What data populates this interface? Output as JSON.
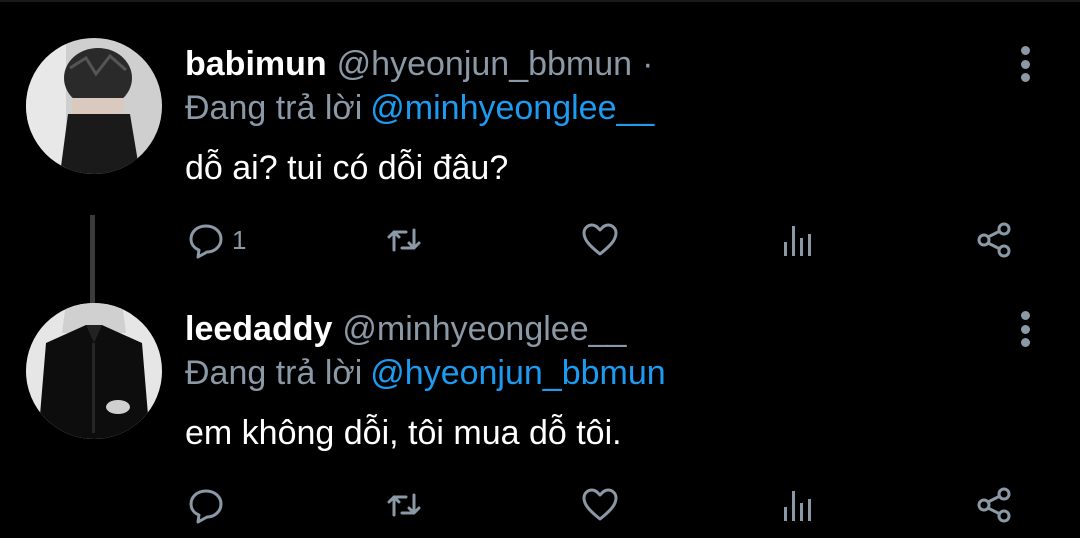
{
  "tweets": [
    {
      "display_name": "babimun",
      "handle": "@hyeonjun_bbmun",
      "separator": "·",
      "reply_prefix": "Đang trả lời",
      "reply_to": "@minhyeonglee__",
      "text": "dỗ ai? tui có dỗi đâu?",
      "reply_count": "1"
    },
    {
      "display_name": "leedaddy",
      "handle": "@minhyeonglee__",
      "reply_prefix": "Đang trả lời",
      "reply_to": "@hyeonjun_bbmun",
      "text": "em không dỗi, tôi mua dỗ tôi.",
      "reply_count": ""
    }
  ],
  "icons": {
    "reply": "speech-bubble-icon",
    "retweet": "retweet-icon",
    "like": "heart-icon",
    "views": "bar-chart-icon",
    "share": "share-icon",
    "more": "vertical-ellipsis-icon"
  },
  "colors": {
    "background": "#000000",
    "primary_text": "#ffffff",
    "secondary_text": "#8b98a5",
    "link": "#1d9bf0"
  }
}
